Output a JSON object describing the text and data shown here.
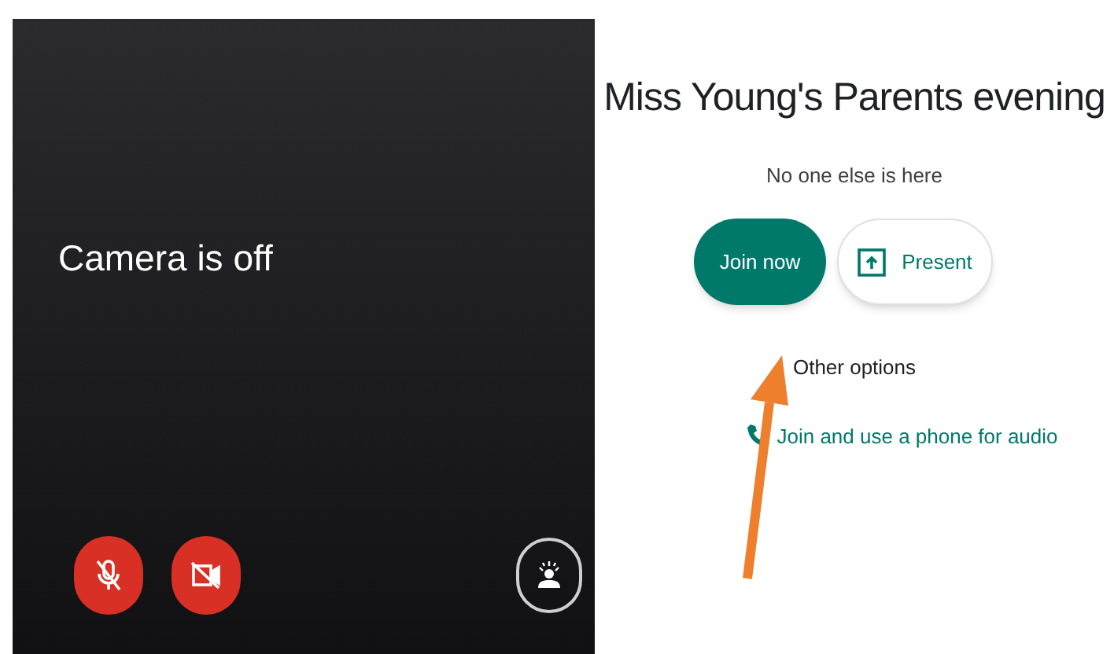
{
  "preview": {
    "message": "Camera is off",
    "mic_on": false,
    "camera_on": false
  },
  "meeting": {
    "title": "Miss Young's Parents evening",
    "status": "No one else is here",
    "buttons": [
      {
        "label": "Join now",
        "kind": "primary"
      },
      {
        "label": "Present",
        "kind": "present"
      }
    ],
    "other_options": "Other options",
    "phone_link": "Join and use a phone for audio"
  }
}
